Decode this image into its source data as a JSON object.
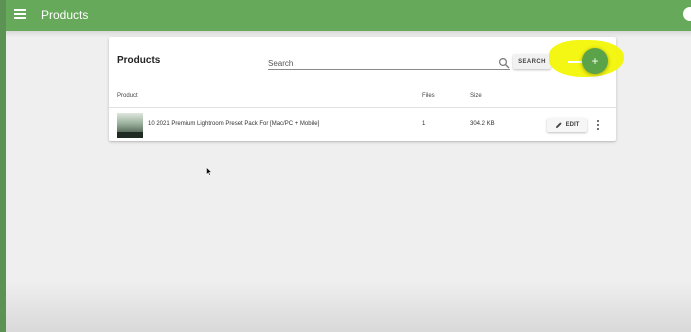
{
  "appbar": {
    "title": "Products"
  },
  "card": {
    "title": "Products",
    "search": {
      "placeholder": "Search",
      "value": "",
      "button_label": "SEARCH"
    },
    "fab_label": "+"
  },
  "table": {
    "headers": {
      "product": "Product",
      "files": "Files",
      "size": "Size"
    },
    "rows": [
      {
        "product": "10 2021 Premium Lightroom Preset Pack For [Mac/PC + Mobile]",
        "files": "1",
        "size": "304.2 KB",
        "edit_label": "EDIT"
      }
    ]
  },
  "icons": {
    "menu": "menu-icon",
    "search": "search-icon",
    "add": "plus-icon",
    "edit": "pencil-icon",
    "more": "more-vert-icon"
  },
  "colors": {
    "appbar": "#66a95a",
    "fab": "#5aa348",
    "highlight": "#f3f600"
  }
}
